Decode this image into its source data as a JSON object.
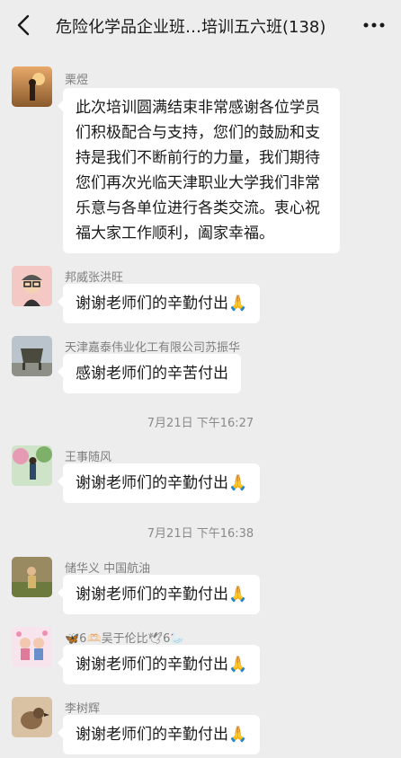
{
  "header": {
    "title": "危险化学品企业班…培训五六班(138)"
  },
  "messages": [
    {
      "sender": "栗煜",
      "text": "此次培训圆满结束非常感谢各位学员们积极配合与支持，您们的鼓励和支持是我们不断前行的力量，我们期待您们再次光临天津职业大学我们非常乐意与各单位进行各类交流。衷心祝福大家工作顺利，阖家幸福。",
      "avatar_icon": "sunset-avatar-icon"
    },
    {
      "sender": "邦威张洪旺",
      "text": "谢谢老师们的辛勤付出",
      "emoji": "🙏",
      "avatar_icon": "cartoon-man-avatar-icon"
    },
    {
      "sender": "天津嘉泰伟业化工有限公司苏振华",
      "text": "感谢老师们的辛苦付出",
      "avatar_icon": "bronze-vessel-avatar-icon"
    },
    {
      "sender": "王事随风",
      "text": "谢谢老师们的辛勤付出",
      "emoji": "🙏",
      "avatar_icon": "person-in-garden-avatar-icon"
    },
    {
      "sender": "储华义  中国航油",
      "text": "谢谢老师们的辛勤付出",
      "emoji": "🙏",
      "avatar_icon": "child-outdoor-avatar-icon"
    },
    {
      "sender": "🦋6🫶🏻吴于伦比🕊6🦢",
      "text": "谢谢老师们的辛勤付出",
      "emoji": "🙏",
      "avatar_icon": "couple-cartoon-avatar-icon"
    },
    {
      "sender": "李树辉",
      "text": "谢谢老师们的辛勤付出",
      "emoji": "🙏",
      "avatar_icon": "bird-avatar-icon"
    }
  ],
  "timestamps": [
    "7月21日 下午16:27",
    "7月21日 下午16:38"
  ],
  "colors": {
    "background": "#ededed",
    "bubble": "#ffffff",
    "sender_text": "#7f7f7f"
  }
}
